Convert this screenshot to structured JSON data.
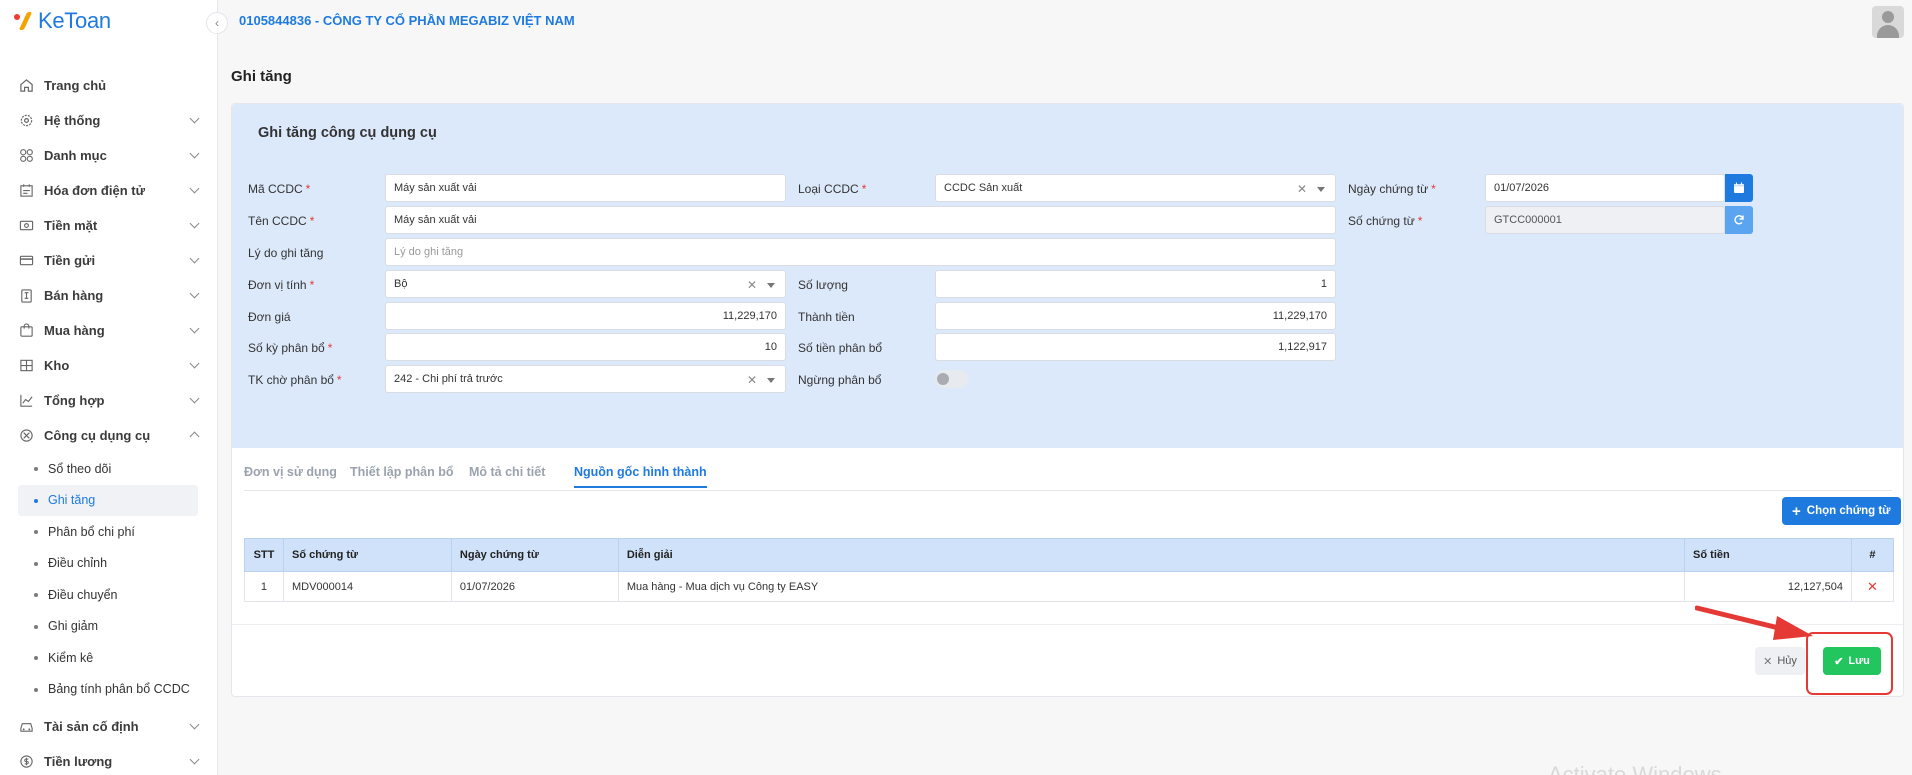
{
  "app": {
    "logo_text": "KeToan",
    "company": "0105844836 - CÔNG TY CỔ PHẦN MEGABIZ VIỆT NAM"
  },
  "sidebar": {
    "items": [
      {
        "label": "Trang chủ",
        "icon": "home-icon",
        "has_chevron": false
      },
      {
        "label": "Hệ thống",
        "icon": "gear-icon",
        "has_chevron": true
      },
      {
        "label": "Danh mục",
        "icon": "grid-icon",
        "has_chevron": true
      },
      {
        "label": "Hóa đơn điện tử",
        "icon": "invoice-icon",
        "has_chevron": true
      },
      {
        "label": "Tiền mặt",
        "icon": "cash-icon",
        "has_chevron": true
      },
      {
        "label": "Tiền gửi",
        "icon": "card-icon",
        "has_chevron": true
      },
      {
        "label": "Bán hàng",
        "icon": "sales-icon",
        "has_chevron": true
      },
      {
        "label": "Mua hàng",
        "icon": "cart-icon",
        "has_chevron": true
      },
      {
        "label": "Kho",
        "icon": "warehouse-icon",
        "has_chevron": true
      },
      {
        "label": "Tổng hợp",
        "icon": "chart-icon",
        "has_chevron": true
      },
      {
        "label": "Công cụ dụng cụ",
        "icon": "tools-icon",
        "has_chevron": true,
        "expanded": true
      }
    ],
    "subitems": [
      {
        "label": "Sổ theo dõi",
        "active": false
      },
      {
        "label": "Ghi tăng",
        "active": true
      },
      {
        "label": "Phân bổ chi phí",
        "active": false
      },
      {
        "label": "Điều chỉnh",
        "active": false
      },
      {
        "label": "Điều chuyển",
        "active": false
      },
      {
        "label": "Ghi giảm",
        "active": false
      },
      {
        "label": "Kiểm kê",
        "active": false
      },
      {
        "label": "Bảng tính phân bổ CCDC",
        "active": false
      }
    ],
    "bottom_items": [
      {
        "label": "Tài sản cố định",
        "icon": "car-icon"
      },
      {
        "label": "Tiền lương",
        "icon": "salary-icon"
      }
    ]
  },
  "page": {
    "title": "Ghi tăng",
    "card_title": "Ghi tăng công cụ dụng cụ"
  },
  "form": {
    "ma_ccdc": {
      "label": "Mã CCDC",
      "value": "Máy sản xuất vải"
    },
    "loai_ccdc": {
      "label": "Loại CCDC",
      "value": "CCDC Sản xuất"
    },
    "ngay_chung_tu": {
      "label": "Ngày chứng từ",
      "value": "01/07/2026"
    },
    "ten_ccdc": {
      "label": "Tên CCDC",
      "value": "Máy sản xuất vải"
    },
    "so_chung_tu": {
      "label": "Số chứng từ",
      "value": "GTCC000001"
    },
    "ly_do": {
      "label": "Lý do ghi tăng",
      "placeholder": "Lý do ghi tăng"
    },
    "don_vi_tinh": {
      "label": "Đơn vị tính",
      "value": "Bộ"
    },
    "so_luong": {
      "label": "Số lượng",
      "value": "1"
    },
    "don_gia": {
      "label": "Đơn giá",
      "value": "11,229,170"
    },
    "thanh_tien": {
      "label": "Thành tiền",
      "value": "11,229,170"
    },
    "so_ky": {
      "label": "Số kỳ phân bổ",
      "value": "10"
    },
    "so_tien_pb": {
      "label": "Số tiền phân bổ",
      "value": "1,122,917"
    },
    "tk_cho_pb": {
      "label": "TK chờ phân bổ",
      "value": "242 - Chi phí trả trước"
    },
    "ngung_pb": {
      "label": "Ngừng phân bổ",
      "enabled": false
    },
    "required_mark": "*"
  },
  "tabs": [
    "Đơn vị sử dụng",
    "Thiết lập phân bổ",
    "Mô tả chi tiết",
    "Nguồn gốc hình thành"
  ],
  "active_tab": 3,
  "buttons": {
    "chon_chung_tu": "Chọn chứng từ",
    "cancel": "Hủy",
    "save": "Lưu"
  },
  "table": {
    "columns": [
      "STT",
      "Số chứng từ",
      "Ngày chứng từ",
      "Diễn giải",
      "Số tiền",
      "#"
    ],
    "rows": [
      {
        "stt": "1",
        "so_ct": "MDV000014",
        "ngay": "01/07/2026",
        "dien_giai": "Mua hàng - Mua dịch vụ Công ty EASY",
        "so_tien": "12,127,504"
      }
    ]
  },
  "colors": {
    "accent": "#1f7ae0",
    "header_bg": "#dce9fb",
    "save": "#22c55e",
    "annotation": "#e53935"
  },
  "watermark": "Activate Windows"
}
